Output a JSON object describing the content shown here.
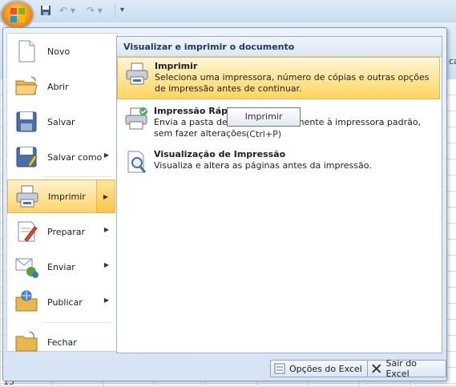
{
  "ribbon": {
    "edge_text": "ca"
  },
  "sheet": {
    "row_number": "15"
  },
  "menu": {
    "items": [
      {
        "label": "Novo",
        "icon": "new-document-icon",
        "has_submenu": false
      },
      {
        "label": "Abrir",
        "icon": "open-folder-icon",
        "has_submenu": false
      },
      {
        "label": "Salvar",
        "icon": "save-icon",
        "has_submenu": false
      },
      {
        "label": "Salvar como",
        "icon": "save-as-icon",
        "has_submenu": true
      },
      {
        "label": "Imprimir",
        "icon": "print-icon",
        "has_submenu": true,
        "active": true
      },
      {
        "label": "Preparar",
        "icon": "prepare-icon",
        "has_submenu": true
      },
      {
        "label": "Enviar",
        "icon": "send-icon",
        "has_submenu": true
      },
      {
        "label": "Publicar",
        "icon": "publish-icon",
        "has_submenu": true
      },
      {
        "label": "Fechar",
        "icon": "close-folder-icon",
        "has_submenu": false
      }
    ],
    "submenu": {
      "header": "Visualizar e imprimir o documento",
      "items": [
        {
          "title": "Imprimir",
          "description": "Seleciona uma impressora, número de cópias e outras opções de impressão antes de continuar.",
          "icon": "printer-icon",
          "active": true
        },
        {
          "title": "Impressão Rápida",
          "description": "Envia a pasta de trabalho diretamente à impressora padrão, sem fazer alterações.",
          "icon": "quick-print-icon"
        },
        {
          "title": "Visualização de Impressão",
          "description": "Visualiza e altera as páginas antes da impressão.",
          "icon": "print-preview-icon"
        }
      ]
    },
    "tooltip": "Imprimir (Ctrl+P)",
    "options_button": "Opções do Excel",
    "exit_button": "Sair do Excel"
  },
  "colors": {
    "highlight": "#ffd36a",
    "border": "#7b9ebd",
    "header_text": "#1e395b"
  }
}
